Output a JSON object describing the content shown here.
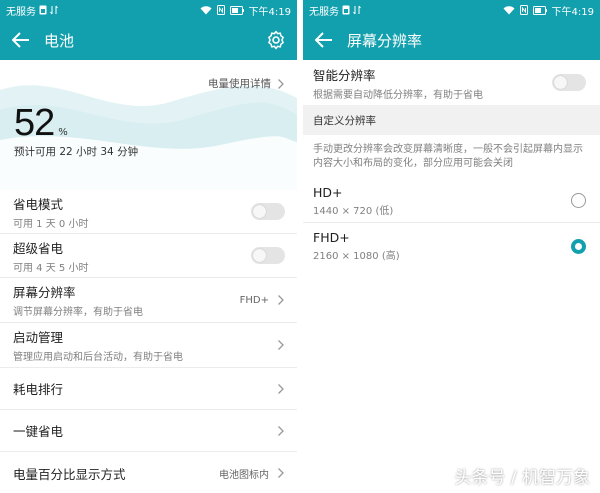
{
  "left": {
    "status": {
      "carrier": "无服务",
      "time": "下午4:19"
    },
    "appbar": {
      "title": "电池"
    },
    "hero": {
      "usage_link": "电量使用详情",
      "percent": "52",
      "percent_unit": "%",
      "remaining": "预计可用 22 小时 34 分钟"
    },
    "rows": [
      {
        "title": "省电模式",
        "subtitle": "可用 1 天 0 小时"
      },
      {
        "title": "超级省电",
        "subtitle": "可用 4 天 5 小时"
      },
      {
        "title": "屏幕分辨率",
        "subtitle": "调节屏幕分辨率，有助于省电",
        "value": "FHD+"
      },
      {
        "title": "启动管理",
        "subtitle": "管理应用启动和后台活动，有助于省电"
      },
      {
        "title": "耗电排行"
      },
      {
        "title": "一键省电"
      },
      {
        "title": "电量百分比显示方式",
        "value": "电池图标内"
      }
    ]
  },
  "right": {
    "status": {
      "carrier": "无服务",
      "time": "下午4:19"
    },
    "appbar": {
      "title": "屏幕分辨率"
    },
    "smart": {
      "title": "智能分辨率",
      "subtitle": "根据需要自动降低分辨率，有助于省电"
    },
    "custom_header": "自定义分辨率",
    "custom_desc": "手动更改分辨率会改变屏幕清晰度，一般不会引起屏幕内显示内容大小和布局的变化，部分应用可能会关闭",
    "options": [
      {
        "title": "HD+",
        "subtitle": "1440 × 720 (低)",
        "selected": false
      },
      {
        "title": "FHD+",
        "subtitle": "2160 × 1080 (高)",
        "selected": true
      }
    ]
  },
  "watermark": "头条号 / 机智万象",
  "colors": {
    "accent": "#13a0ae"
  }
}
